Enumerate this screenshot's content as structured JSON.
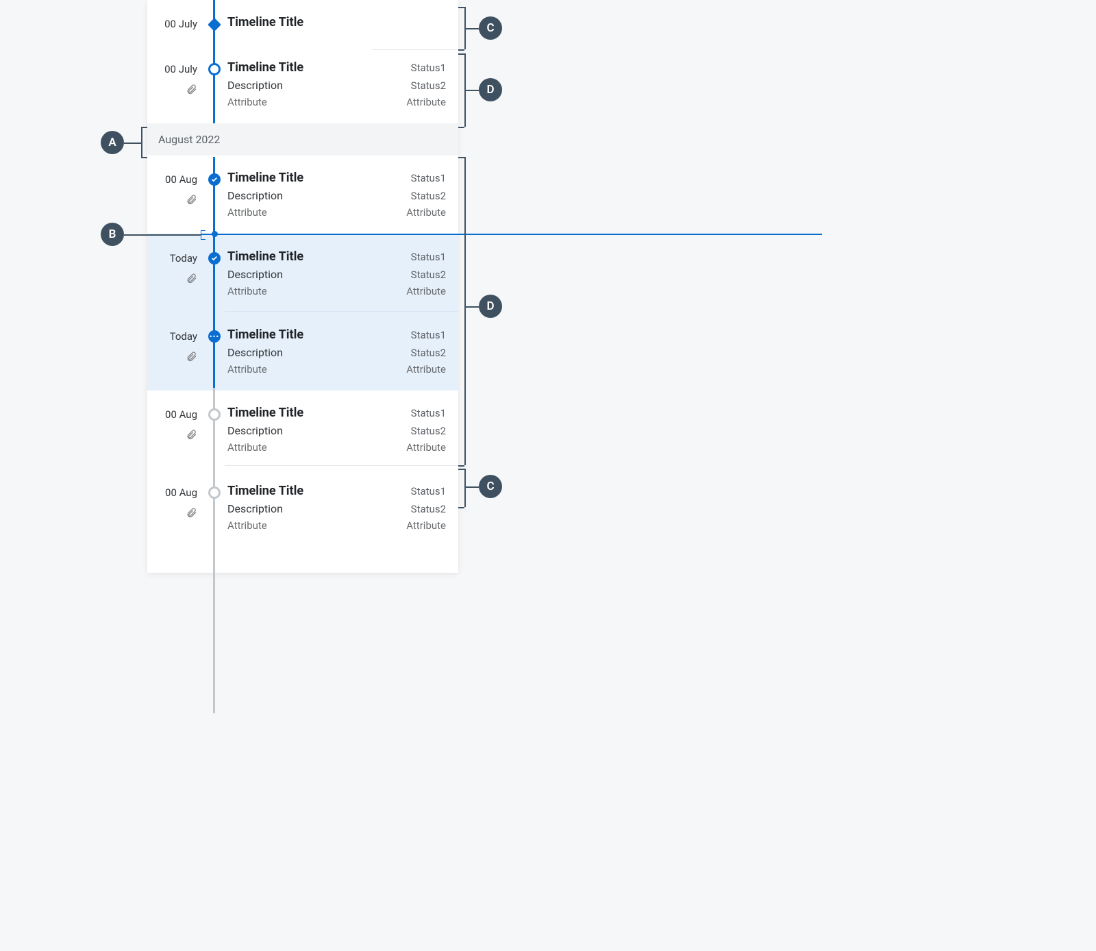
{
  "annotations": {
    "a": "A",
    "b": "B",
    "c": "C",
    "d": "D"
  },
  "group_header": "August 2022",
  "items": [
    {
      "date": "00 July",
      "title": "Timeline Title",
      "attach": false,
      "desc": "",
      "attr": "",
      "status1": "",
      "status2": "",
      "attr2": "",
      "node": "diamond"
    },
    {
      "date": "00 July",
      "title": "Timeline Title",
      "attach": true,
      "desc": "Description",
      "attr": "Attribute",
      "status1": "Status1",
      "status2": "Status2",
      "attr2": "Attribute",
      "node": "open-blue"
    },
    {
      "date": "00 Aug",
      "title": "Timeline Title",
      "attach": true,
      "desc": "Description",
      "attr": "Attribute",
      "status1": "Status1",
      "status2": "Status2",
      "attr2": "Attribute",
      "node": "check"
    },
    {
      "date": "Today",
      "title": "Timeline Title",
      "attach": true,
      "desc": "Description",
      "attr": "Attribute",
      "status1": "Status1",
      "status2": "Status2",
      "attr2": "Attribute",
      "node": "check"
    },
    {
      "date": "Today",
      "title": "Timeline Title",
      "attach": true,
      "desc": "Description",
      "attr": "Attribute",
      "status1": "Status1",
      "status2": "Status2",
      "attr2": "Attribute",
      "node": "ellipsis"
    },
    {
      "date": "00 Aug",
      "title": "Timeline Title",
      "attach": true,
      "desc": "Description",
      "attr": "Attribute",
      "status1": "Status1",
      "status2": "Status2",
      "attr2": "Attribute",
      "node": "open-gray"
    },
    {
      "date": "00 Aug",
      "title": "Timeline Title",
      "attach": true,
      "desc": "Description",
      "attr": "Attribute",
      "status1": "Status1",
      "status2": "Status2",
      "attr2": "Attribute",
      "node": "open-gray"
    }
  ]
}
